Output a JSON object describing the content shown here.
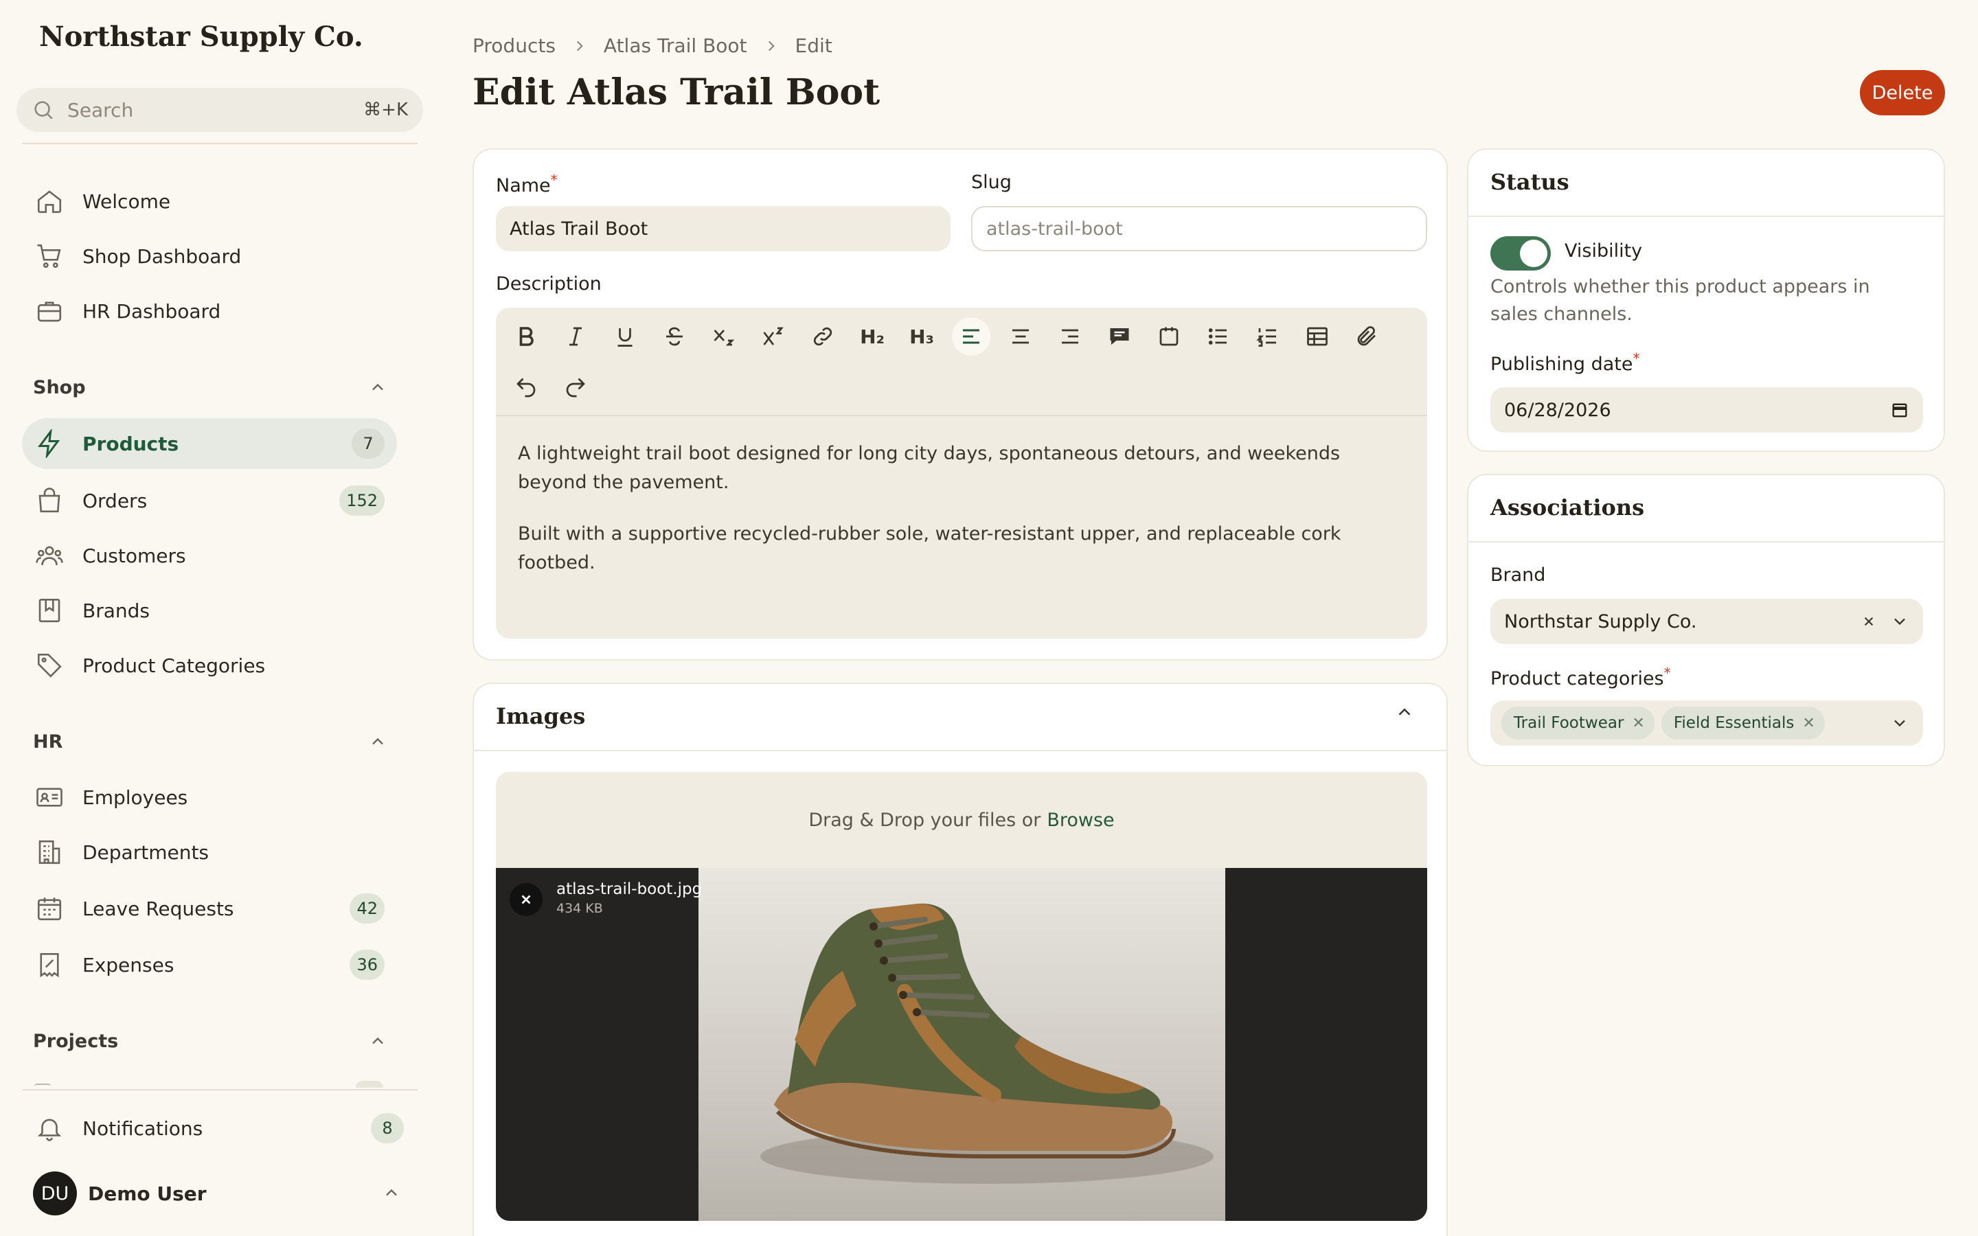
{
  "app": {
    "brand": "Northstar Supply Co."
  },
  "search": {
    "placeholder": "Search",
    "shortcut": "⌘+K"
  },
  "nav": {
    "top": [
      {
        "label": "Welcome",
        "icon": "home-icon"
      },
      {
        "label": "Shop Dashboard",
        "icon": "cart-icon"
      },
      {
        "label": "HR Dashboard",
        "icon": "briefcase-icon"
      }
    ],
    "shop": {
      "title": "Shop",
      "items": [
        {
          "label": "Products",
          "count": "7",
          "active": true,
          "icon": "bolt-icon"
        },
        {
          "label": "Orders",
          "count": "152",
          "icon": "bag-icon"
        },
        {
          "label": "Customers",
          "icon": "users-icon"
        },
        {
          "label": "Brands",
          "icon": "bookmark-icon"
        },
        {
          "label": "Product Categories",
          "icon": "tag-icon"
        }
      ]
    },
    "hr": {
      "title": "HR",
      "items": [
        {
          "label": "Employees",
          "icon": "id-card-icon"
        },
        {
          "label": "Departments",
          "icon": "building-icon"
        },
        {
          "label": "Leave Requests",
          "count": "42",
          "icon": "calendar-icon"
        },
        {
          "label": "Expenses",
          "count": "36",
          "icon": "receipt-icon"
        }
      ]
    },
    "projects": {
      "title": "Projects"
    },
    "notifications": {
      "label": "Notifications",
      "count": "8",
      "icon": "bell-icon"
    }
  },
  "user": {
    "initials": "DU",
    "name": "Demo User"
  },
  "breadcrumb": [
    "Products",
    "Atlas Trail Boot",
    "Edit"
  ],
  "page": {
    "title": "Edit Atlas Trail Boot",
    "delete_label": "Delete"
  },
  "form": {
    "name_label": "Name",
    "name_value": "Atlas Trail Boot",
    "slug_label": "Slug",
    "slug_value": "atlas-trail-boot",
    "description_label": "Description",
    "description_paragraphs": [
      "A lightweight trail boot designed for long city days, spontaneous detours, and weekends beyond the pavement.",
      "Built with a supportive recycled-rubber sole, water-resistant upper, and replaceable cork footbed."
    ],
    "toolbar": {
      "h2": "H₂",
      "h3": "H₃"
    }
  },
  "images": {
    "title": "Images",
    "drop_text": "Drag & Drop your files or",
    "browse": "Browse",
    "file_name": "atlas-trail-boot.jpg",
    "file_size": "434 KB"
  },
  "status": {
    "title": "Status",
    "visibility_label": "Visibility",
    "visibility_on": true,
    "visibility_help": "Controls whether this product appears in sales channels.",
    "publishing_label": "Publishing date",
    "publishing_value": "06/28/2026"
  },
  "associations": {
    "title": "Associations",
    "brand_label": "Brand",
    "brand_value": "Northstar Supply Co.",
    "categories_label": "Product categories",
    "categories": [
      "Trail Footwear",
      "Field Essentials"
    ]
  },
  "colors": {
    "accent": "#245a3c",
    "danger": "#c43a12",
    "toggle_on": "#3f7553"
  }
}
